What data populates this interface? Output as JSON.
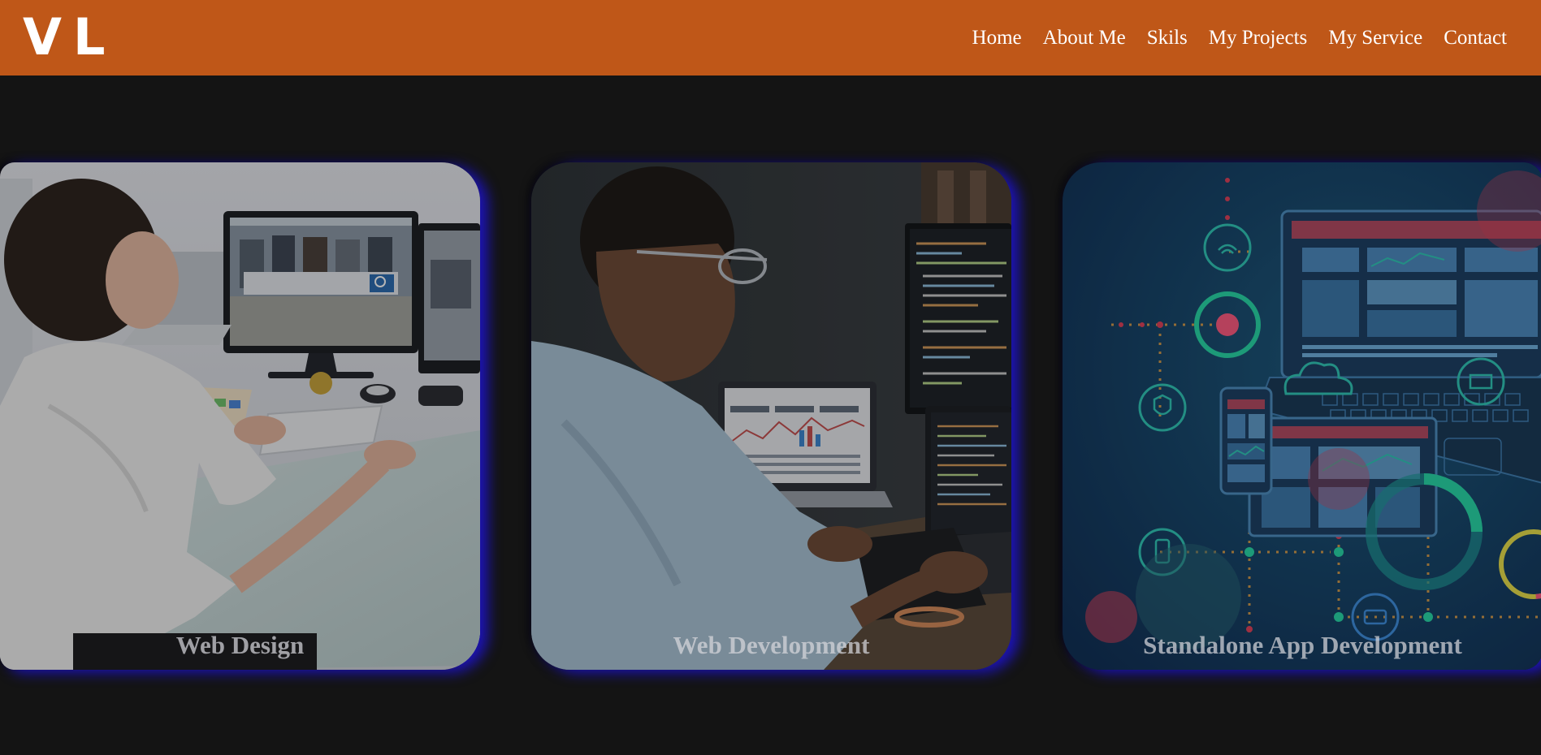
{
  "header": {
    "logo_text": "VL",
    "nav": [
      {
        "label": "Home"
      },
      {
        "label": "About Me"
      },
      {
        "label": "Skils"
      },
      {
        "label": "My Projects"
      },
      {
        "label": "My Service"
      },
      {
        "label": "Contact"
      }
    ]
  },
  "services": [
    {
      "title": "Web Design",
      "image": "woman-at-desk-with-monitors"
    },
    {
      "title": "Web Development",
      "image": "man-coding-on-laptops"
    },
    {
      "title": "Standalone App Development",
      "image": "devices-network-illustration"
    }
  ],
  "colors": {
    "header_bg": "#bf5718",
    "page_bg": "#141414",
    "card_glow": "#1e14d2",
    "nav_text": "#ffffff"
  }
}
